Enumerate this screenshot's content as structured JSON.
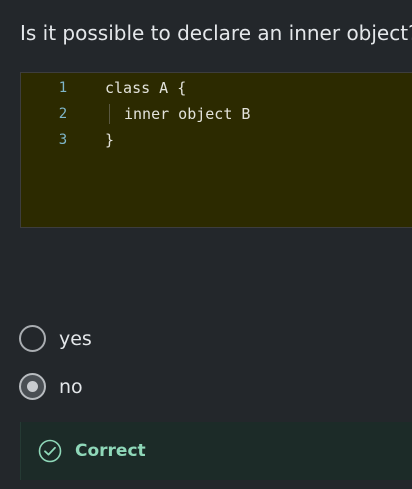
{
  "question": {
    "text": "Is it possible to declare an inner object?"
  },
  "code": {
    "lines": [
      {
        "number": "1",
        "text": "class A {"
      },
      {
        "number": "2",
        "text": "inner object B"
      },
      {
        "number": "3",
        "text": "}"
      }
    ],
    "background_color": "#2c2a00"
  },
  "options": [
    {
      "label": "yes",
      "selected": false
    },
    {
      "label": "no",
      "selected": true
    }
  ],
  "feedback": {
    "status": "Correct",
    "icon": "check-circle-icon",
    "color": "#8fd8b9"
  }
}
